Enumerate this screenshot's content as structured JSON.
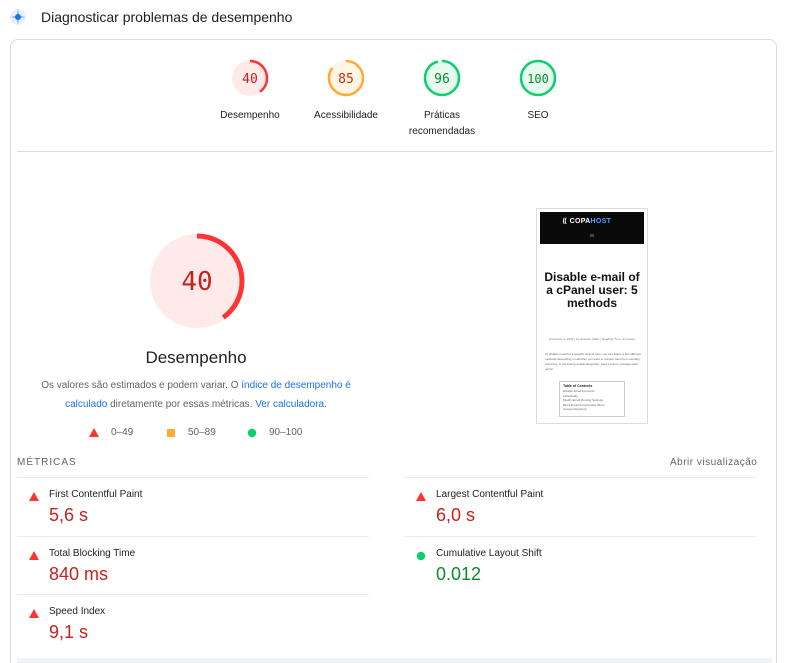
{
  "header": {
    "title": "Diagnosticar problemas de desempenho",
    "icon": "lighthouse-icon"
  },
  "categories": [
    {
      "label": "Desempenho",
      "score": 40,
      "rating": "fail"
    },
    {
      "label": "Acessibilidade",
      "score": 85,
      "rating": "average"
    },
    {
      "label": "Práticas recomendadas",
      "score": 96,
      "rating": "pass"
    },
    {
      "label": "SEO",
      "score": 100,
      "rating": "pass"
    }
  ],
  "performance": {
    "score": 40,
    "title": "Desempenho",
    "desc_part1": "Os valores são estimados e podem variar. O ",
    "desc_link1": "índice de desempenho é calculado",
    "desc_part2": " diretamente por essas métricas. ",
    "desc_link2": "Ver calculadora",
    "desc_part3": "."
  },
  "legend": [
    {
      "range": "0–49",
      "shape": "triangle",
      "color": "#ff3333"
    },
    {
      "range": "50–89",
      "shape": "square",
      "color": "#ffaa33"
    },
    {
      "range": "90–100",
      "shape": "circle",
      "color": "#0cce6b"
    }
  ],
  "screenshot": {
    "logo_a": "COPA",
    "logo_b": "HOST",
    "headline": "Disable e-mail of a cPanel user: 5 methods",
    "meta": "November 3, 2024 | by Gustavo Valter | Reading Time: 3 minutes",
    "paragraph": "To disable email for a specific cPanel user, you can follow a few different methods depending on whether you want to prevent them from sending, receiving, or accessing emails altogether. Here's how to manage each option:",
    "toc_title": "Table of Contents",
    "toc_items": [
      "Disable Email Accounts",
      "Individually",
      "Modify Email Routing Settings",
      "Block Email Functionality (Root",
      "Access Required)"
    ]
  },
  "metrics": {
    "label": "MÉTRICAS",
    "expand": "Abrir visualização",
    "items": [
      {
        "name": "First Contentful Paint",
        "value": "5,6 s",
        "rating": "fail"
      },
      {
        "name": "Largest Contentful Paint",
        "value": "6,0 s",
        "rating": "fail"
      },
      {
        "name": "Total Blocking Time",
        "value": "840 ms",
        "rating": "fail"
      },
      {
        "name": "Cumulative Layout Shift",
        "value": "0.012",
        "rating": "pass"
      },
      {
        "name": "Speed Index",
        "value": "9,1 s",
        "rating": "fail"
      }
    ]
  },
  "colors": {
    "fail": "#ff3333",
    "average": "#ffaa33",
    "pass": "#0cce6b",
    "fail_text": "#c5221f",
    "pass_text": "#0d8a2f",
    "link": "#1a73e8"
  }
}
